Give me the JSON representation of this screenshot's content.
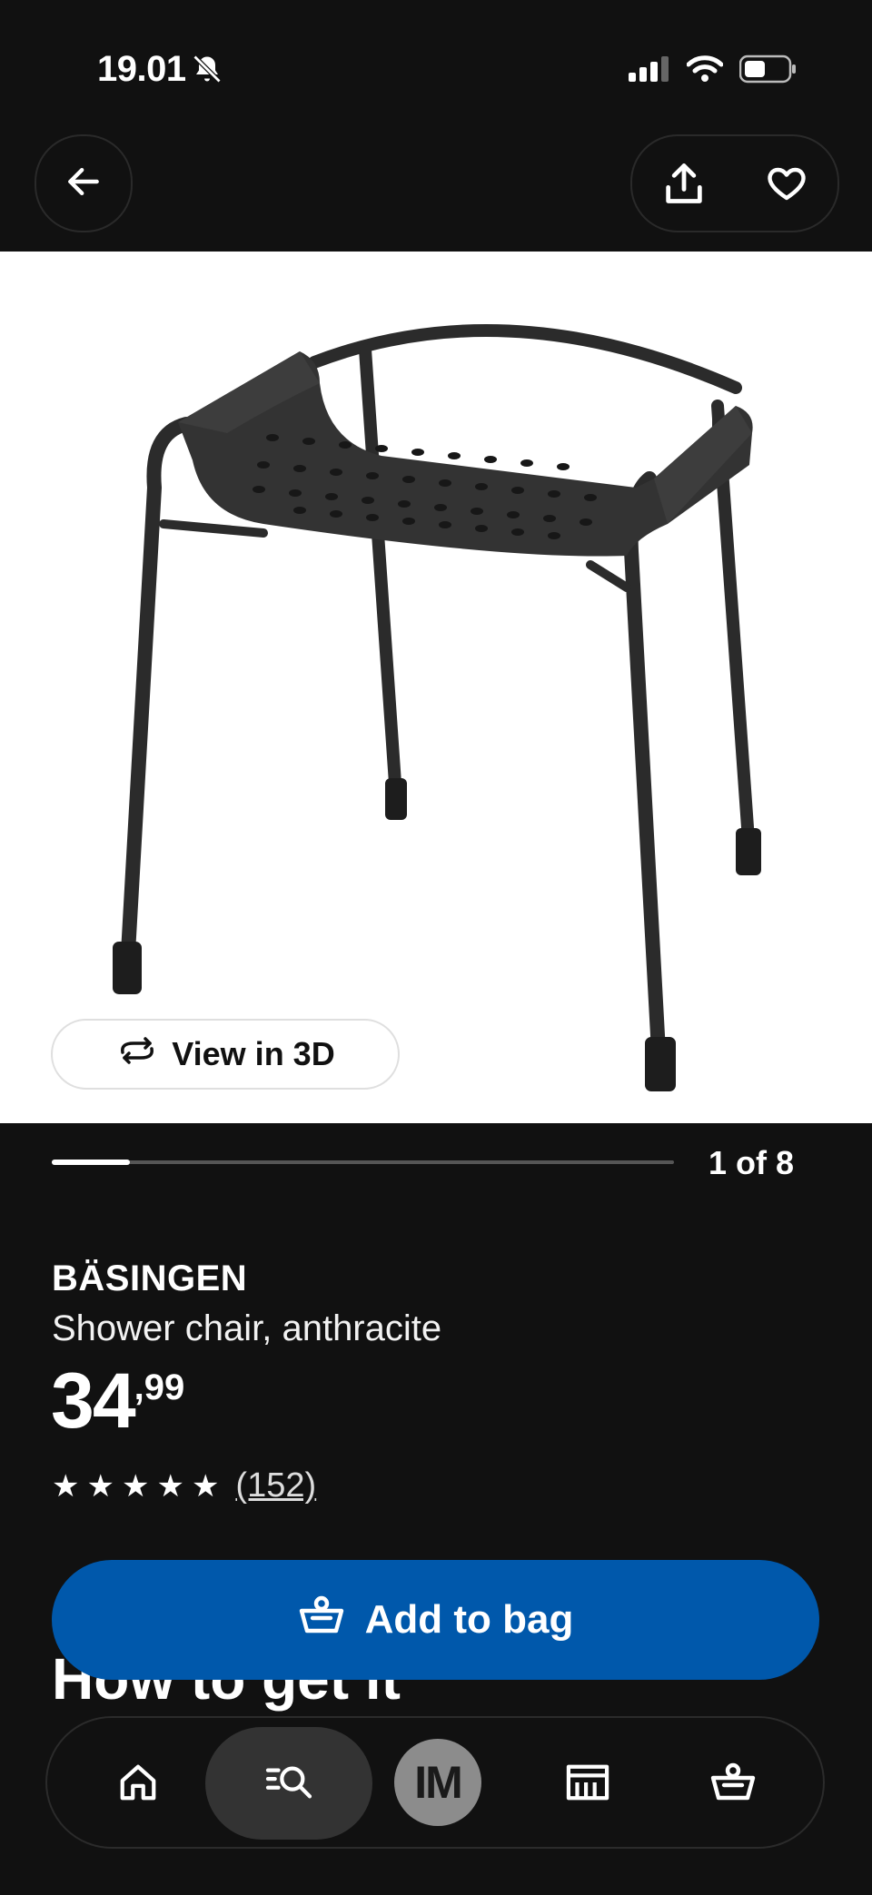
{
  "status_bar": {
    "time": "19.01",
    "icons": [
      "bell-slash-icon",
      "signal-icon",
      "wifi-icon",
      "battery-icon"
    ]
  },
  "header": {
    "back_icon": "arrow-left-icon",
    "share_icon": "share-icon",
    "favorite_icon": "heart-icon"
  },
  "gallery": {
    "view_3d_label": "View in 3D",
    "position_label": "1 of 8",
    "current": 1,
    "total": 8
  },
  "product": {
    "brand": "BÄSINGEN",
    "description": "Shower chair, anthracite",
    "price_integer": "34",
    "price_decimal": ",99",
    "rating": 5,
    "review_count": "(152)"
  },
  "section_heading": "How to get it",
  "cta": {
    "add_to_bag_label": "Add to bag",
    "bag_icon": "basket-icon"
  },
  "bottom_nav": {
    "items": [
      {
        "icon": "home-icon"
      },
      {
        "icon": "search-icon",
        "active": true
      },
      {
        "avatar_initials": "IM"
      },
      {
        "icon": "store-icon"
      },
      {
        "icon": "basket-icon"
      }
    ]
  },
  "colors": {
    "background": "#111111",
    "accent_blue": "#0058ab",
    "image_bg": "#ffffff"
  }
}
